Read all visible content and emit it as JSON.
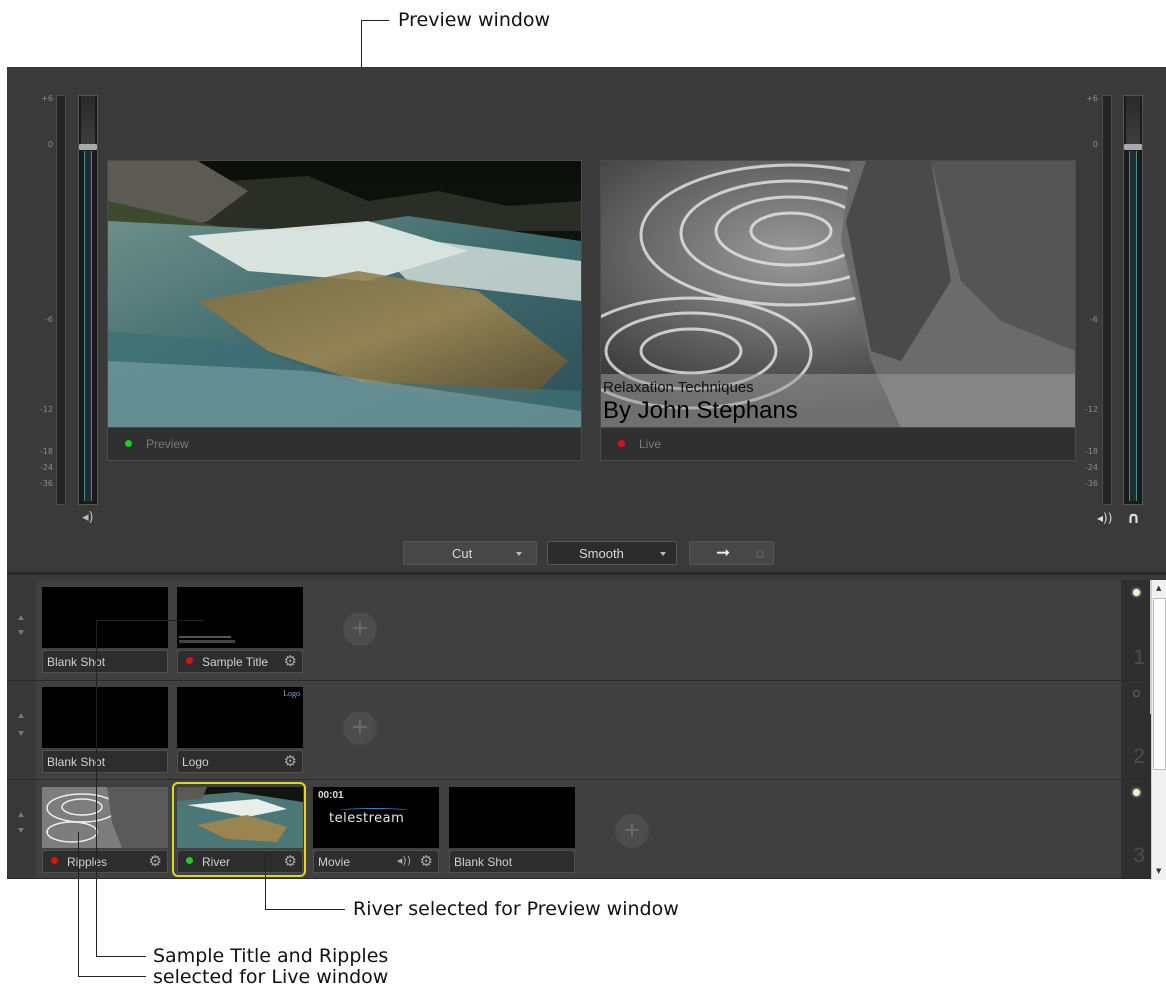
{
  "callouts": {
    "preview": "Preview window",
    "river": "River selected for Preview window",
    "sample_line1": "Sample Title and Ripples",
    "sample_line2": "selected for Live window"
  },
  "vu_scale": [
    "+6",
    "0",
    "-6",
    "-12",
    "-18",
    "-24",
    "-36"
  ],
  "monitors": {
    "preview_label": "Preview",
    "live_label": "Live",
    "live_title_line1": "Relaxation Techniques",
    "live_title_line2": "By John Stephans"
  },
  "transition": {
    "cut_label": "Cut",
    "smooth_label": "Smooth"
  },
  "layers": [
    {
      "number": "1",
      "shots": [
        {
          "label": "Blank Shot"
        },
        {
          "label": "Sample Title",
          "status": "live"
        }
      ]
    },
    {
      "number": "2",
      "shots": [
        {
          "label": "Blank Shot"
        },
        {
          "label": "Logo",
          "thumb_text": "Logo"
        }
      ]
    },
    {
      "number": "3",
      "shots": [
        {
          "label": "Ripples",
          "status": "live"
        },
        {
          "label": "River",
          "status": "preview",
          "selected": true
        },
        {
          "label": "Movie",
          "timecode": "00:01",
          "thumb_text": "telestream"
        },
        {
          "label": "Blank Shot"
        }
      ]
    }
  ],
  "colors": {
    "live": "#e01010",
    "preview": "#22cc22",
    "selected_border": "#e4d61c",
    "app_background": "#3a3a3a"
  }
}
